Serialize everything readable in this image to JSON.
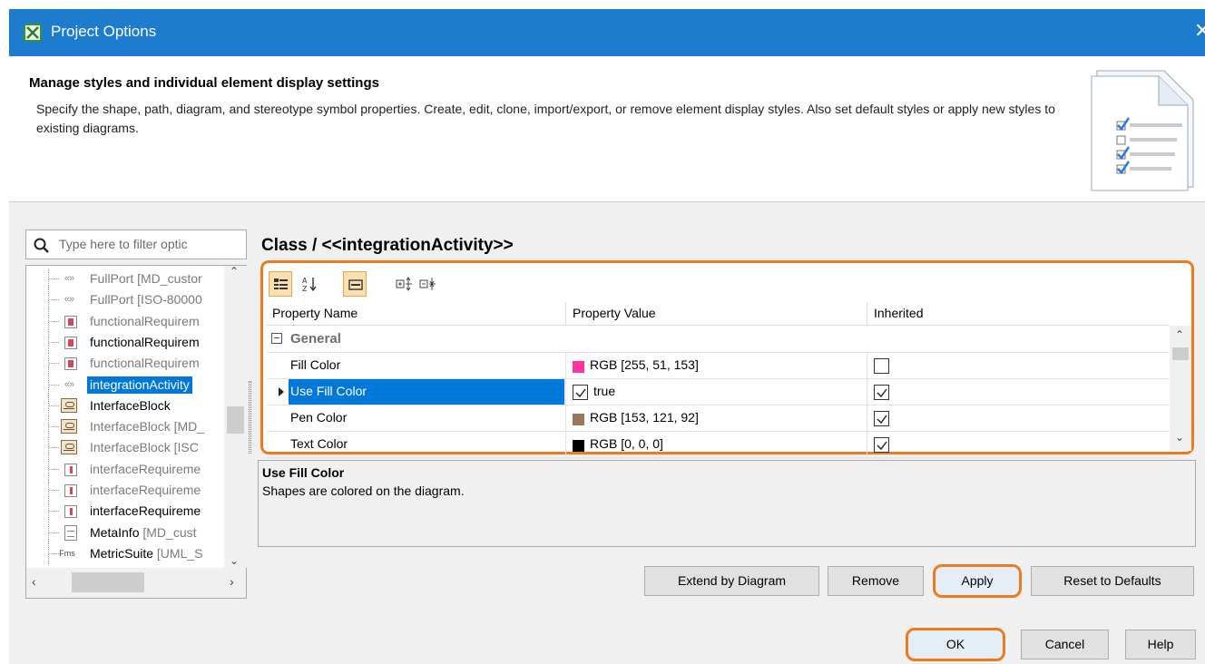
{
  "window": {
    "title": "Project Options"
  },
  "header": {
    "title": "Manage styles and individual element display settings",
    "description": "Specify the shape, path, diagram, and stereotype symbol properties. Create, edit, clone, import/export, or remove element display styles. Also set default styles or apply new styles to existing diagrams."
  },
  "filter": {
    "placeholder": "Type here to filter optic"
  },
  "tree": {
    "items": [
      {
        "icon": "stereotype-icon",
        "label": "FullPort",
        "suffix": " [MD_custor",
        "dim": true
      },
      {
        "icon": "stereotype-icon",
        "label": "FullPort",
        "suffix": " [ISO-80000",
        "dim": true
      },
      {
        "icon": "requirement-icon",
        "label": "functionalRequirem",
        "suffix": "",
        "dim": true
      },
      {
        "icon": "requirement-icon",
        "label": "functionalRequirem",
        "suffix": "",
        "dim": false
      },
      {
        "icon": "requirement-icon",
        "label": "functionalRequirem",
        "suffix": "",
        "dim": true
      },
      {
        "icon": "stereotype-icon",
        "label": "integrationActivity",
        "suffix": "",
        "dim": false,
        "selected": true
      },
      {
        "icon": "interface-block-icon",
        "label": "InterfaceBlock",
        "suffix": "",
        "dim": false
      },
      {
        "icon": "interface-block-icon",
        "label": "InterfaceBlock",
        "suffix": " [MD_",
        "dim": true
      },
      {
        "icon": "interface-block-icon",
        "label": "InterfaceBlock",
        "suffix": " [ISC",
        "dim": true
      },
      {
        "icon": "interface-requirement-icon",
        "label": "interfaceRequireme",
        "suffix": "",
        "dim": true
      },
      {
        "icon": "interface-requirement-icon",
        "label": "interfaceRequireme",
        "suffix": "",
        "dim": true
      },
      {
        "icon": "interface-requirement-icon",
        "label": "interfaceRequireme",
        "suffix": "",
        "dim": false
      },
      {
        "icon": "document-icon",
        "label": "MetaInfo",
        "suffix": " [MD_cust",
        "dim": false
      },
      {
        "icon": "metric-suite-icon",
        "label": "MetricSuite",
        "suffix": " [UML_S",
        "dim": false
      }
    ]
  },
  "main": {
    "heading": "Class / <<integrationActivity>>",
    "columns": {
      "name": "Property Name",
      "value": "Property Value",
      "inherited": "Inherited"
    },
    "group": "General",
    "rows": [
      {
        "name": "Fill Color",
        "value": "RGB [255, 51, 153]",
        "swatch": "#ff3399",
        "inherited": false
      },
      {
        "name": "Use Fill Color",
        "value": "true",
        "checkbox": true,
        "inherited": true,
        "selected": true
      },
      {
        "name": "Pen Color",
        "value": "RGB [153, 121, 92]",
        "swatch": "#99795c",
        "inherited": true
      },
      {
        "name": "Text Color",
        "value": "RGB [0, 0, 0]",
        "swatch": "#000000",
        "inherited": true
      }
    ],
    "description": {
      "title": "Use Fill Color",
      "text": "Shapes are colored on the diagram."
    }
  },
  "buttons": {
    "extend": "Extend by Diagram",
    "remove": "Remove",
    "apply": "Apply",
    "reset": "Reset to Defaults",
    "ok": "OK",
    "cancel": "Cancel",
    "help": "Help"
  },
  "colors": {
    "titlebar": "#1e7ccf",
    "selection": "#0078d7",
    "highlight": "#ee7a1e"
  }
}
